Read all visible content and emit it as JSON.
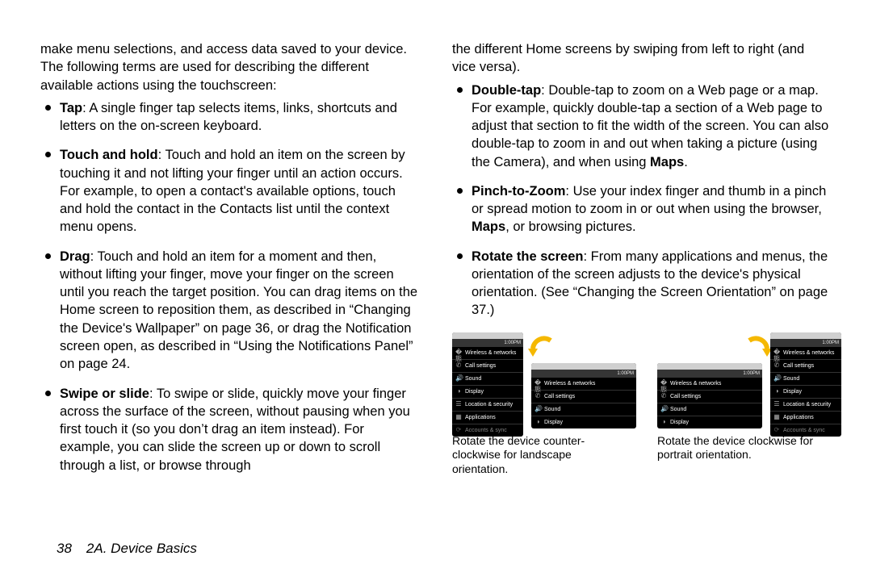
{
  "footer": {
    "page_num": "38",
    "section": "2A. Device Basics"
  },
  "col1": {
    "intro": "make menu selections, and access data saved to your device. The following terms are used for describing the different available actions using the touchscreen:",
    "items": [
      {
        "term": "Tap",
        "text": ": A single finger tap selects items, links, shortcuts and letters on the on-screen keyboard."
      },
      {
        "term": "Touch and hold",
        "text": ": Touch and hold an item on the screen by touching it and not lifting your finger until an action occurs. For example, to open a contact's available options, touch and hold the contact in the Contacts list until the context menu opens."
      },
      {
        "term": "Drag",
        "text": ": Touch and hold an item for a moment and then, without lifting your finger, move your finger on the screen until you reach the target position. You can drag items on the Home screen to reposition them, as described in “Changing the Device's Wallpaper” on page 36, or drag the Notification screen open, as described in “Using the Notifications Panel” on page 24."
      },
      {
        "term": "Swipe or slide",
        "text": ": To swipe or slide, quickly move your finger across the surface of the screen, without pausing when you first touch it (so you don’t drag an item instead). For example, you can slide the screen up or down to scroll through a list, or browse through"
      }
    ]
  },
  "col2": {
    "tail": "the different Home screens by swiping from left to right (and vice versa).",
    "items": [
      {
        "term": "Double-tap",
        "pre": ": Double-tap to zoom on a Web page or a map. For example, quickly double-tap a section of a Web page to adjust that section to fit the width of the screen. You can also double-tap to zoom in and out when taking a picture (using the Camera), and when using ",
        "bold2": "Maps",
        "post": "."
      },
      {
        "term": "Pinch-to-Zoom",
        "pre": ": Use your index finger and thumb in a pinch or spread motion to zoom in or out when using the browser, ",
        "bold2": "Maps",
        "post": ", or browsing pictures."
      },
      {
        "term": "Rotate the screen",
        "pre": ": From many applications and menus, the orientation of the screen adjusts to the device's physical orientation. (See “Changing the Screen Orientation” on page 37.)",
        "bold2": "",
        "post": ""
      }
    ]
  },
  "diagrams": {
    "ccw_caption": "Rotate the device counter-clockwise for landscape orientation.",
    "cw_caption": "Rotate the device clockwise for portrait orientation.",
    "time": "1:00PM",
    "menu": [
      "Wireless & networks",
      "Call settings",
      "Sound",
      "Display",
      "Location & security",
      "Applications",
      "Accounts & sync"
    ],
    "menu_short": [
      "Wireless & networks",
      "Call settings",
      "Sound",
      "Display"
    ]
  }
}
